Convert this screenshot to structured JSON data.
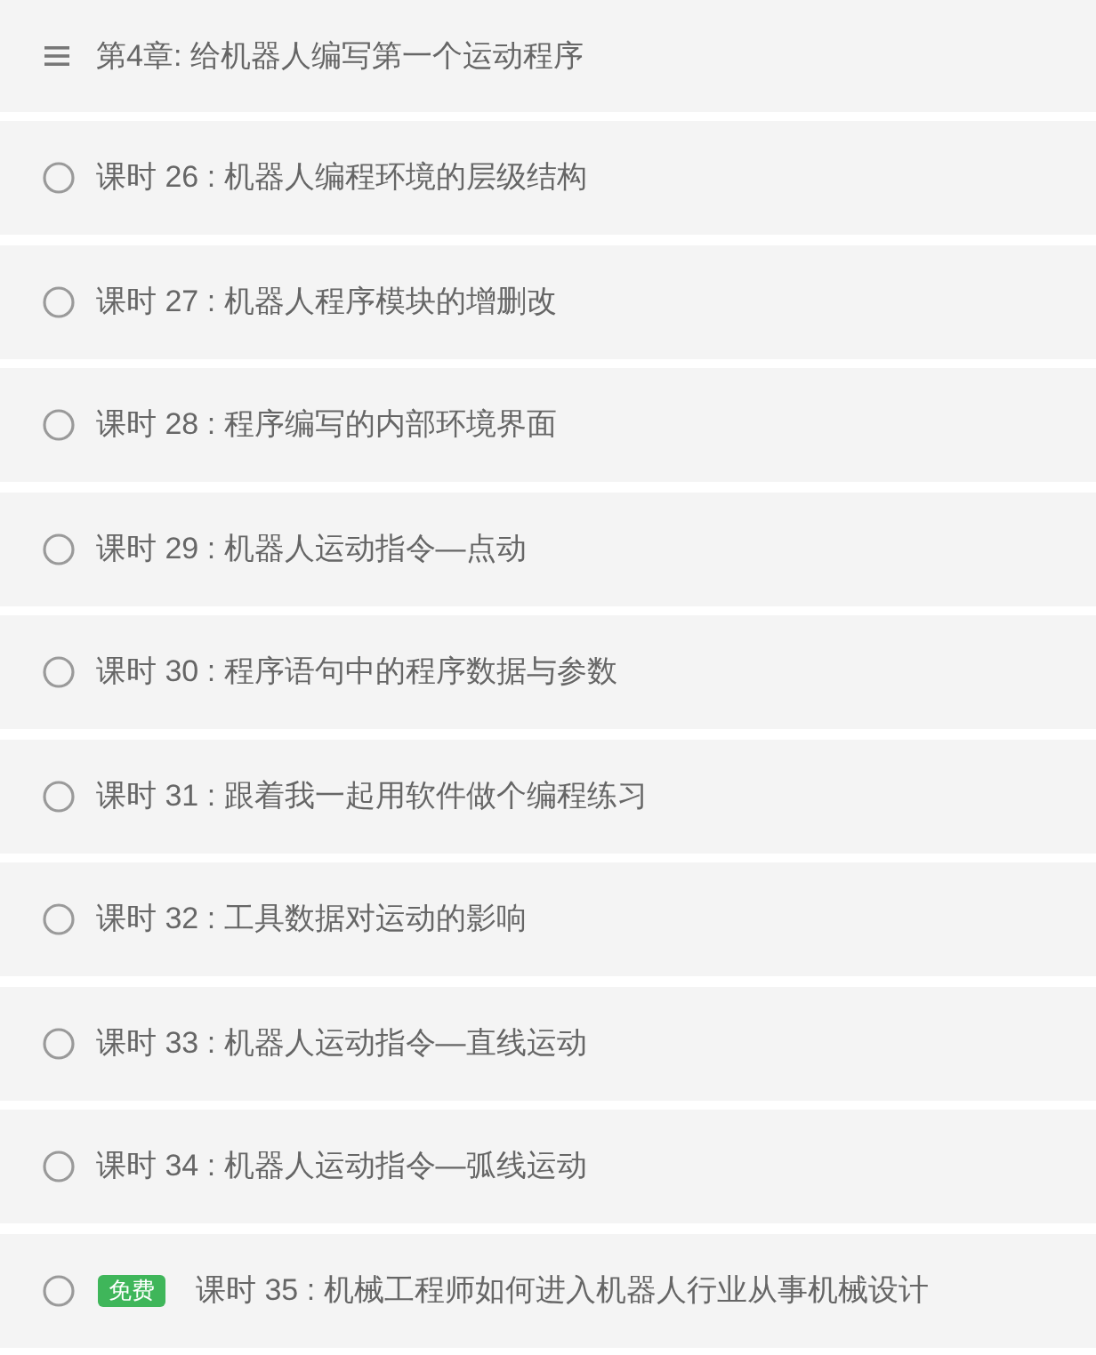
{
  "chapter": {
    "title": "第4章: 给机器人编写第一个运动程序"
  },
  "lessons": [
    {
      "title": "课时 26 : 机器人编程环境的层级结构"
    },
    {
      "title": "课时 27 : 机器人程序模块的增删改"
    },
    {
      "title": "课时 28 : 程序编写的内部环境界面"
    },
    {
      "title": "课时 29 : 机器人运动指令—点动"
    },
    {
      "title": "课时 30 : 程序语句中的程序数据与参数"
    },
    {
      "title": "课时 31 : 跟着我一起用软件做个编程练习"
    },
    {
      "title": "课时 32 : 工具数据对运动的影响"
    },
    {
      "title": "课时 33 : 机器人运动指令—直线运动"
    },
    {
      "title": "课时 34 : 机器人运动指令—弧线运动"
    },
    {
      "title": "课时 35 : 机械工程师如何进入机器人行业从事机械设计",
      "badge": "免费"
    }
  ]
}
